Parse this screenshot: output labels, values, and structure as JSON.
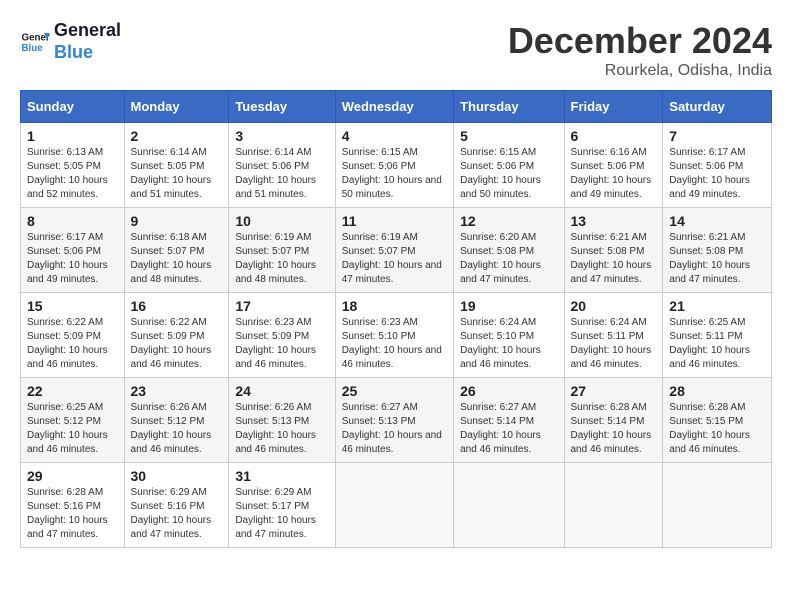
{
  "header": {
    "logo_line1": "General",
    "logo_line2": "Blue",
    "month": "December 2024",
    "location": "Rourkela, Odisha, India"
  },
  "weekdays": [
    "Sunday",
    "Monday",
    "Tuesday",
    "Wednesday",
    "Thursday",
    "Friday",
    "Saturday"
  ],
  "weeks": [
    [
      {
        "day": "1",
        "sunrise": "6:13 AM",
        "sunset": "5:05 PM",
        "daylight": "10 hours and 52 minutes."
      },
      {
        "day": "2",
        "sunrise": "6:14 AM",
        "sunset": "5:05 PM",
        "daylight": "10 hours and 51 minutes."
      },
      {
        "day": "3",
        "sunrise": "6:14 AM",
        "sunset": "5:06 PM",
        "daylight": "10 hours and 51 minutes."
      },
      {
        "day": "4",
        "sunrise": "6:15 AM",
        "sunset": "5:06 PM",
        "daylight": "10 hours and 50 minutes."
      },
      {
        "day": "5",
        "sunrise": "6:15 AM",
        "sunset": "5:06 PM",
        "daylight": "10 hours and 50 minutes."
      },
      {
        "day": "6",
        "sunrise": "6:16 AM",
        "sunset": "5:06 PM",
        "daylight": "10 hours and 49 minutes."
      },
      {
        "day": "7",
        "sunrise": "6:17 AM",
        "sunset": "5:06 PM",
        "daylight": "10 hours and 49 minutes."
      }
    ],
    [
      {
        "day": "8",
        "sunrise": "6:17 AM",
        "sunset": "5:06 PM",
        "daylight": "10 hours and 49 minutes."
      },
      {
        "day": "9",
        "sunrise": "6:18 AM",
        "sunset": "5:07 PM",
        "daylight": "10 hours and 48 minutes."
      },
      {
        "day": "10",
        "sunrise": "6:19 AM",
        "sunset": "5:07 PM",
        "daylight": "10 hours and 48 minutes."
      },
      {
        "day": "11",
        "sunrise": "6:19 AM",
        "sunset": "5:07 PM",
        "daylight": "10 hours and 47 minutes."
      },
      {
        "day": "12",
        "sunrise": "6:20 AM",
        "sunset": "5:08 PM",
        "daylight": "10 hours and 47 minutes."
      },
      {
        "day": "13",
        "sunrise": "6:21 AM",
        "sunset": "5:08 PM",
        "daylight": "10 hours and 47 minutes."
      },
      {
        "day": "14",
        "sunrise": "6:21 AM",
        "sunset": "5:08 PM",
        "daylight": "10 hours and 47 minutes."
      }
    ],
    [
      {
        "day": "15",
        "sunrise": "6:22 AM",
        "sunset": "5:09 PM",
        "daylight": "10 hours and 46 minutes."
      },
      {
        "day": "16",
        "sunrise": "6:22 AM",
        "sunset": "5:09 PM",
        "daylight": "10 hours and 46 minutes."
      },
      {
        "day": "17",
        "sunrise": "6:23 AM",
        "sunset": "5:09 PM",
        "daylight": "10 hours and 46 minutes."
      },
      {
        "day": "18",
        "sunrise": "6:23 AM",
        "sunset": "5:10 PM",
        "daylight": "10 hours and 46 minutes."
      },
      {
        "day": "19",
        "sunrise": "6:24 AM",
        "sunset": "5:10 PM",
        "daylight": "10 hours and 46 minutes."
      },
      {
        "day": "20",
        "sunrise": "6:24 AM",
        "sunset": "5:11 PM",
        "daylight": "10 hours and 46 minutes."
      },
      {
        "day": "21",
        "sunrise": "6:25 AM",
        "sunset": "5:11 PM",
        "daylight": "10 hours and 46 minutes."
      }
    ],
    [
      {
        "day": "22",
        "sunrise": "6:25 AM",
        "sunset": "5:12 PM",
        "daylight": "10 hours and 46 minutes."
      },
      {
        "day": "23",
        "sunrise": "6:26 AM",
        "sunset": "5:12 PM",
        "daylight": "10 hours and 46 minutes."
      },
      {
        "day": "24",
        "sunrise": "6:26 AM",
        "sunset": "5:13 PM",
        "daylight": "10 hours and 46 minutes."
      },
      {
        "day": "25",
        "sunrise": "6:27 AM",
        "sunset": "5:13 PM",
        "daylight": "10 hours and 46 minutes."
      },
      {
        "day": "26",
        "sunrise": "6:27 AM",
        "sunset": "5:14 PM",
        "daylight": "10 hours and 46 minutes."
      },
      {
        "day": "27",
        "sunrise": "6:28 AM",
        "sunset": "5:14 PM",
        "daylight": "10 hours and 46 minutes."
      },
      {
        "day": "28",
        "sunrise": "6:28 AM",
        "sunset": "5:15 PM",
        "daylight": "10 hours and 46 minutes."
      }
    ],
    [
      {
        "day": "29",
        "sunrise": "6:28 AM",
        "sunset": "5:16 PM",
        "daylight": "10 hours and 47 minutes."
      },
      {
        "day": "30",
        "sunrise": "6:29 AM",
        "sunset": "5:16 PM",
        "daylight": "10 hours and 47 minutes."
      },
      {
        "day": "31",
        "sunrise": "6:29 AM",
        "sunset": "5:17 PM",
        "daylight": "10 hours and 47 minutes."
      },
      null,
      null,
      null,
      null
    ]
  ]
}
